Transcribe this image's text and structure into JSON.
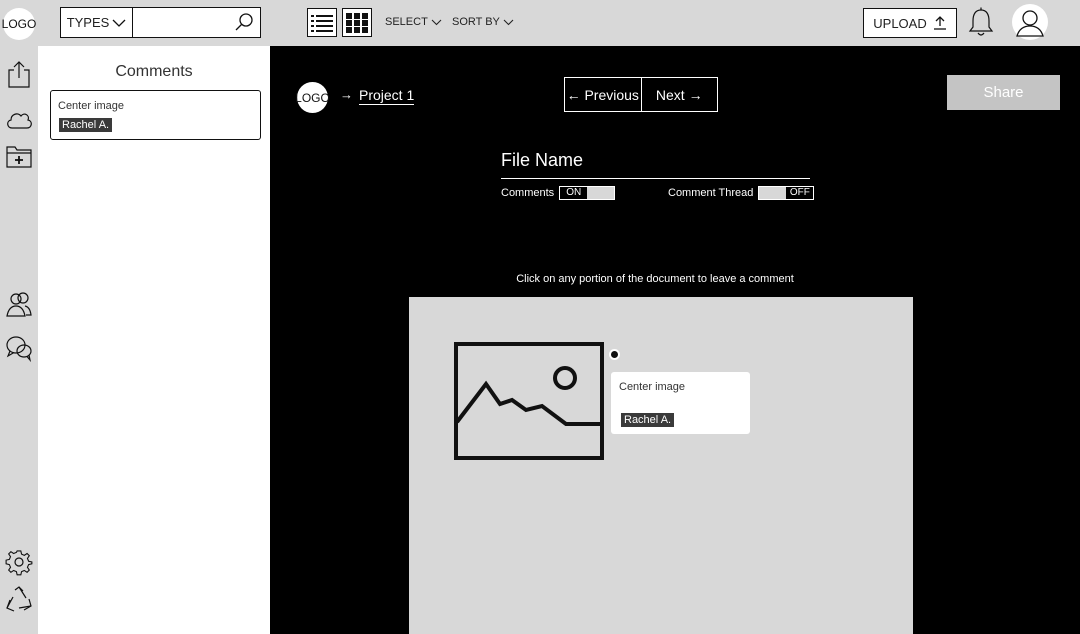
{
  "topbar": {
    "logo": "LOGO",
    "types_label": "TYPES",
    "search_placeholder": "",
    "select_label": "SELECT",
    "sort_label": "SORT BY",
    "upload_label": "UPLOAD"
  },
  "comments_panel": {
    "title": "Comments",
    "items": [
      {
        "text": "Center image",
        "author": "Rachel A."
      }
    ]
  },
  "main": {
    "crumb_logo": "LOGO",
    "crumb_arrow": "→",
    "project_link": "Project 1",
    "prev_label": "← Previous",
    "next_label": "Next →",
    "share_label": "Share",
    "file_name": "File Name",
    "comments_toggle": {
      "label": "Comments",
      "state_label": "ON"
    },
    "thread_toggle": {
      "label": "Comment Thread",
      "state_label": "OFF"
    },
    "hint": "Click on any portion of the document  to leave a comment",
    "popup": {
      "text": "Center image",
      "author": "Rachel A."
    }
  },
  "colors": {
    "chrome": "#d8d8d8",
    "main_bg": "#000000",
    "tag_bg": "#3a3a3a",
    "share_bg": "#c4c4c4"
  },
  "icons": {
    "rail": [
      "share-upload-icon",
      "cloud-icon",
      "folder-add-icon",
      "users-icon",
      "chat-icon",
      "settings-gear-icon",
      "recycle-icon"
    ],
    "topbar": [
      "search-icon",
      "list-view-icon",
      "grid-view-icon",
      "chevron-down-icon",
      "upload-arrow-icon",
      "bell-icon",
      "user-avatar-icon"
    ]
  }
}
